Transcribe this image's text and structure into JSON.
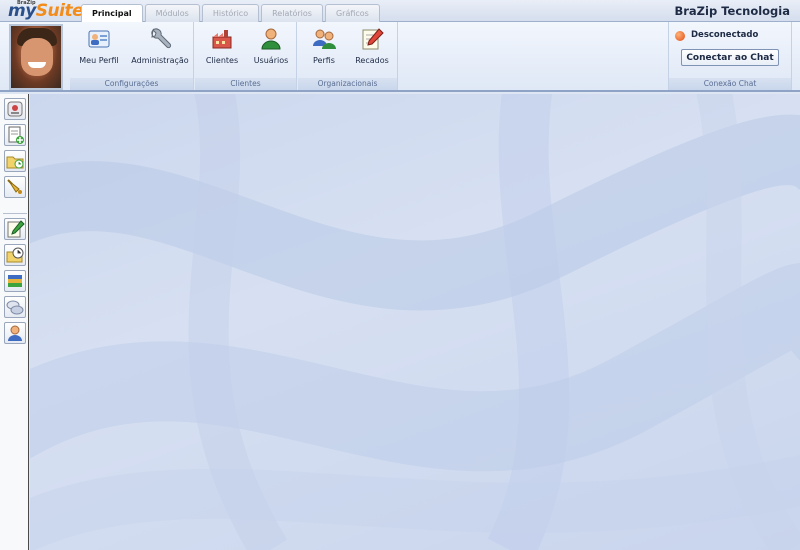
{
  "app": {
    "logo_small": "BraZip",
    "logo_my": "my",
    "logo_suite": "Suite",
    "company": "BraZip Tecnologia"
  },
  "tabs": [
    {
      "label": "Principal",
      "active": true
    },
    {
      "label": "Módulos",
      "active": false
    },
    {
      "label": "Histórico",
      "active": false
    },
    {
      "label": "Relatórios",
      "active": false
    },
    {
      "label": "Gráficos",
      "active": false
    }
  ],
  "ribbon": {
    "groups": [
      {
        "label": "Configurações",
        "buttons": [
          {
            "label": "Meu Perfil",
            "icon": "profile-card-icon"
          },
          {
            "label": "Administração",
            "icon": "wrench-icon"
          }
        ]
      },
      {
        "label": "Clientes",
        "buttons": [
          {
            "label": "Clientes",
            "icon": "factory-icon"
          },
          {
            "label": "Usuários",
            "icon": "user-icon"
          }
        ]
      },
      {
        "label": "Organizacionais",
        "buttons": [
          {
            "label": "Perfis",
            "icon": "users-group-icon"
          },
          {
            "label": "Recados",
            "icon": "note-pencil-icon"
          }
        ]
      }
    ],
    "chat": {
      "status": "Desconectado",
      "status_color": "#e04a12",
      "connect_label": "Conectar ao Chat",
      "group_label": "Conexão Chat"
    }
  },
  "left_toolbar": {
    "icons": [
      "contact-card-icon",
      "new-document-icon",
      "folder-schedule-icon",
      "bell-icon",
      "edit-note-icon",
      "clock-folder-icon",
      "stack-books-icon",
      "chat-bubbles-icon",
      "person-icon"
    ]
  },
  "colors": {
    "accent": "#2a4f8a",
    "logo_orange": "#f28c1b",
    "workspace": "#cbd7ee"
  }
}
